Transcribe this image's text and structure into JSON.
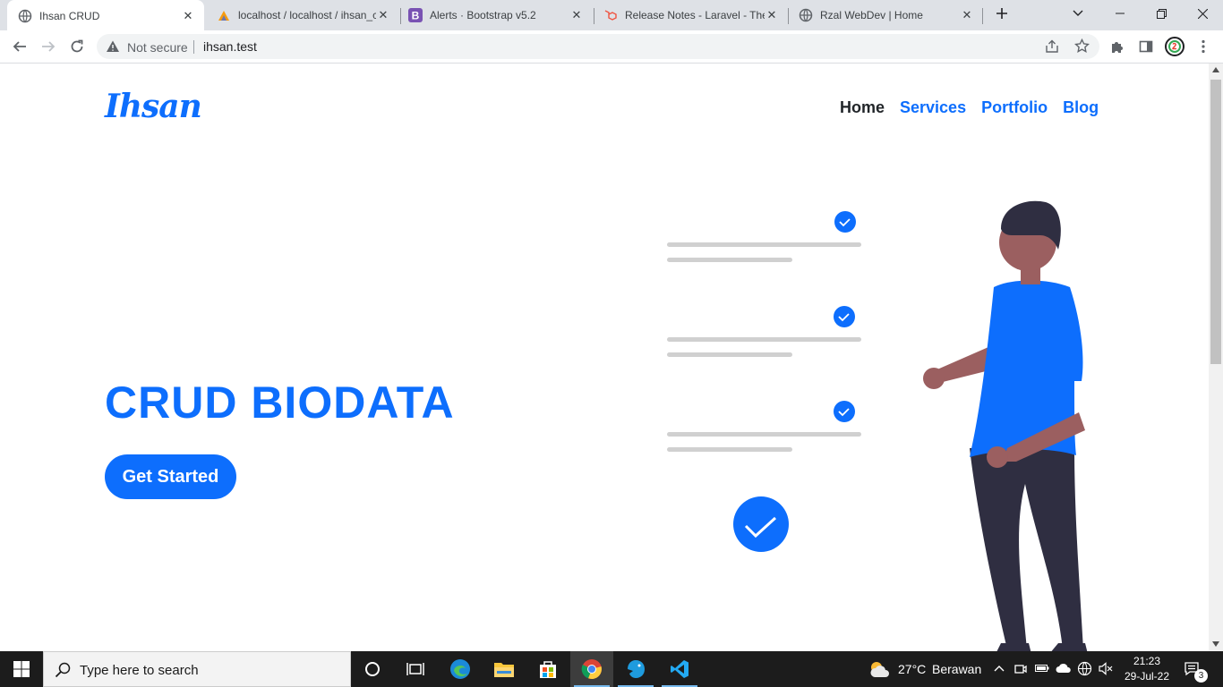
{
  "browser": {
    "tabs": [
      {
        "title": "Ihsan CRUD",
        "icon": "globe-icon",
        "active": true
      },
      {
        "title": "localhost / localhost / ihsan_c",
        "icon": "phpmyadmin-icon",
        "active": false
      },
      {
        "title": "Alerts · Bootstrap v5.2",
        "icon": "bootstrap-icon",
        "active": false
      },
      {
        "title": "Release Notes - Laravel - The",
        "icon": "laravel-icon",
        "active": false
      },
      {
        "title": "Rzal WebDev | Home",
        "icon": "globe-icon",
        "active": false
      }
    ],
    "security_label": "Not secure",
    "url": "ihsan.test"
  },
  "site": {
    "brand": "Ihsan",
    "nav": [
      {
        "label": "Home",
        "current": true
      },
      {
        "label": "Services",
        "current": false
      },
      {
        "label": "Portfolio",
        "current": false
      },
      {
        "label": "Blog",
        "current": false
      }
    ],
    "hero_title": "CRUD BIODATA",
    "cta_label": "Get Started",
    "accent_color": "#0d6efd"
  },
  "taskbar": {
    "search_placeholder": "Type here to search",
    "weather": {
      "temp": "27°C",
      "condition": "Berawan"
    },
    "time": "21:23",
    "date": "29-Jul-22",
    "notification_count": "3"
  }
}
